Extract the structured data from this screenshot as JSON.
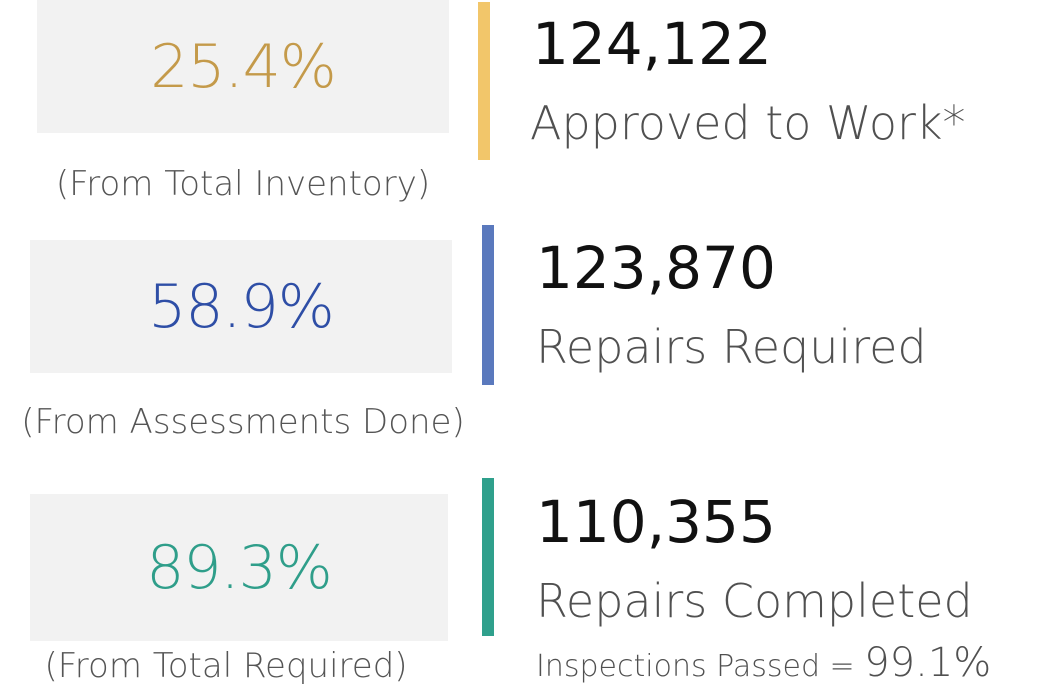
{
  "colors": {
    "gold": "#c49a4a",
    "blue": "#2e4ea6",
    "teal": "#2f9e8a",
    "gold_bar": "#f2c66a",
    "blue_bar": "#5a79bd",
    "teal_bar": "#2fa08c",
    "box_bg": "#f2f2f2"
  },
  "rows": [
    {
      "percent": "25.4%",
      "percent_note": "(From Total Inventory)",
      "count": "124,122",
      "label": "Approved to Work*"
    },
    {
      "percent": "58.9%",
      "percent_note": "(From Assessments Done)",
      "count": "123,870",
      "label": "Repairs Required"
    },
    {
      "percent": "89.3%",
      "percent_note": "(From Total Required)",
      "count": "110,355",
      "label": "Repairs Completed",
      "footnote_label": "Inspections Passed = ",
      "footnote_value": "99.1%"
    }
  ]
}
